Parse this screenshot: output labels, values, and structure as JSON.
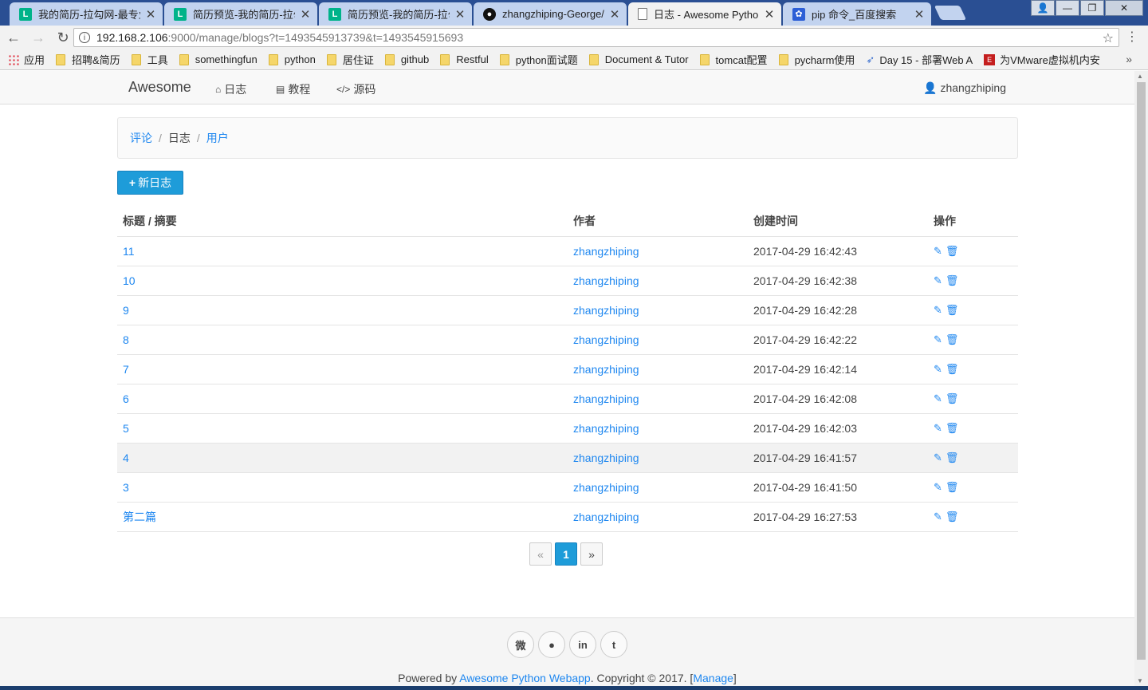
{
  "browser": {
    "tabs": [
      {
        "title": "我的简历-拉勾网-最专业",
        "favicon": "lagou-icon",
        "active": false
      },
      {
        "title": "简历预览-我的简历-拉勾",
        "favicon": "lagou-icon",
        "active": false
      },
      {
        "title": "简历预览-我的简历-拉勾",
        "favicon": "lagou-icon",
        "active": false
      },
      {
        "title": "zhangzhiping-George/",
        "favicon": "github-icon",
        "active": false
      },
      {
        "title": "日志 - Awesome Pytho",
        "favicon": "page-icon",
        "active": true
      },
      {
        "title": "pip 命令_百度搜索",
        "favicon": "baidu-icon",
        "active": false
      }
    ],
    "url_host": "192.168.2.106",
    "url_rest": ":9000/manage/blogs?t=1493545913739&t=1493545915693",
    "bookmarks": [
      {
        "label": "应用",
        "icon": "apps-icon"
      },
      {
        "label": "招聘&简历",
        "icon": "folder-icon"
      },
      {
        "label": "工具",
        "icon": "folder-icon"
      },
      {
        "label": "somethingfun",
        "icon": "folder-icon"
      },
      {
        "label": "python",
        "icon": "folder-icon"
      },
      {
        "label": "居住证",
        "icon": "folder-icon"
      },
      {
        "label": "github",
        "icon": "folder-icon"
      },
      {
        "label": "Restful",
        "icon": "folder-icon"
      },
      {
        "label": "python面试题",
        "icon": "folder-icon"
      },
      {
        "label": "Document & Tutor",
        "icon": "folder-icon"
      },
      {
        "label": "tomcat配置",
        "icon": "folder-icon"
      },
      {
        "label": "pycharm使用",
        "icon": "folder-icon"
      },
      {
        "label": "Day 15 - 部署Web A",
        "icon": "rocket-icon"
      },
      {
        "label": "为VMware虚拟机内安",
        "icon": "red-icon"
      }
    ],
    "bookmarks_more": "»"
  },
  "navbar": {
    "brand": "Awesome",
    "links": [
      {
        "label": "日志",
        "icon": "home-icon"
      },
      {
        "label": "教程",
        "icon": "book-icon"
      },
      {
        "label": "源码",
        "icon": "code-icon"
      }
    ],
    "user": "zhangzhiping"
  },
  "breadcrumb": {
    "comments": "评论",
    "blogs": "日志",
    "users": "用户",
    "separator": "/"
  },
  "new_blog_button": "新日志",
  "table": {
    "headers": [
      "标题 / 摘要",
      "作者",
      "创建时间",
      "操作"
    ],
    "rows": [
      {
        "title": "11",
        "author": "zhangzhiping",
        "created": "2017-04-29 16:42:43"
      },
      {
        "title": "10",
        "author": "zhangzhiping",
        "created": "2017-04-29 16:42:38"
      },
      {
        "title": "9",
        "author": "zhangzhiping",
        "created": "2017-04-29 16:42:28"
      },
      {
        "title": "8",
        "author": "zhangzhiping",
        "created": "2017-04-29 16:42:22"
      },
      {
        "title": "7",
        "author": "zhangzhiping",
        "created": "2017-04-29 16:42:14"
      },
      {
        "title": "6",
        "author": "zhangzhiping",
        "created": "2017-04-29 16:42:08"
      },
      {
        "title": "5",
        "author": "zhangzhiping",
        "created": "2017-04-29 16:42:03"
      },
      {
        "title": "4",
        "author": "zhangzhiping",
        "created": "2017-04-29 16:41:57"
      },
      {
        "title": "3",
        "author": "zhangzhiping",
        "created": "2017-04-29 16:41:50"
      },
      {
        "title": "第二篇",
        "author": "zhangzhiping",
        "created": "2017-04-29 16:27:53"
      }
    ],
    "highlighted_row": 7
  },
  "pagination": {
    "prev": "«",
    "current": "1",
    "next": "»"
  },
  "footer": {
    "social_icons": [
      "weibo-icon",
      "github-icon",
      "linkedin-icon",
      "twitter-icon"
    ],
    "powered_prefix": "Powered by ",
    "powered_link": "Awesome Python Webapp",
    "copyright": ". Copyright © 2017. [",
    "manage_link": "Manage",
    "close_bracket": "]"
  },
  "colors": {
    "accent": "#1e87f0",
    "primary_button": "#1e9cd9",
    "tabstrip": "#2a4f93"
  }
}
